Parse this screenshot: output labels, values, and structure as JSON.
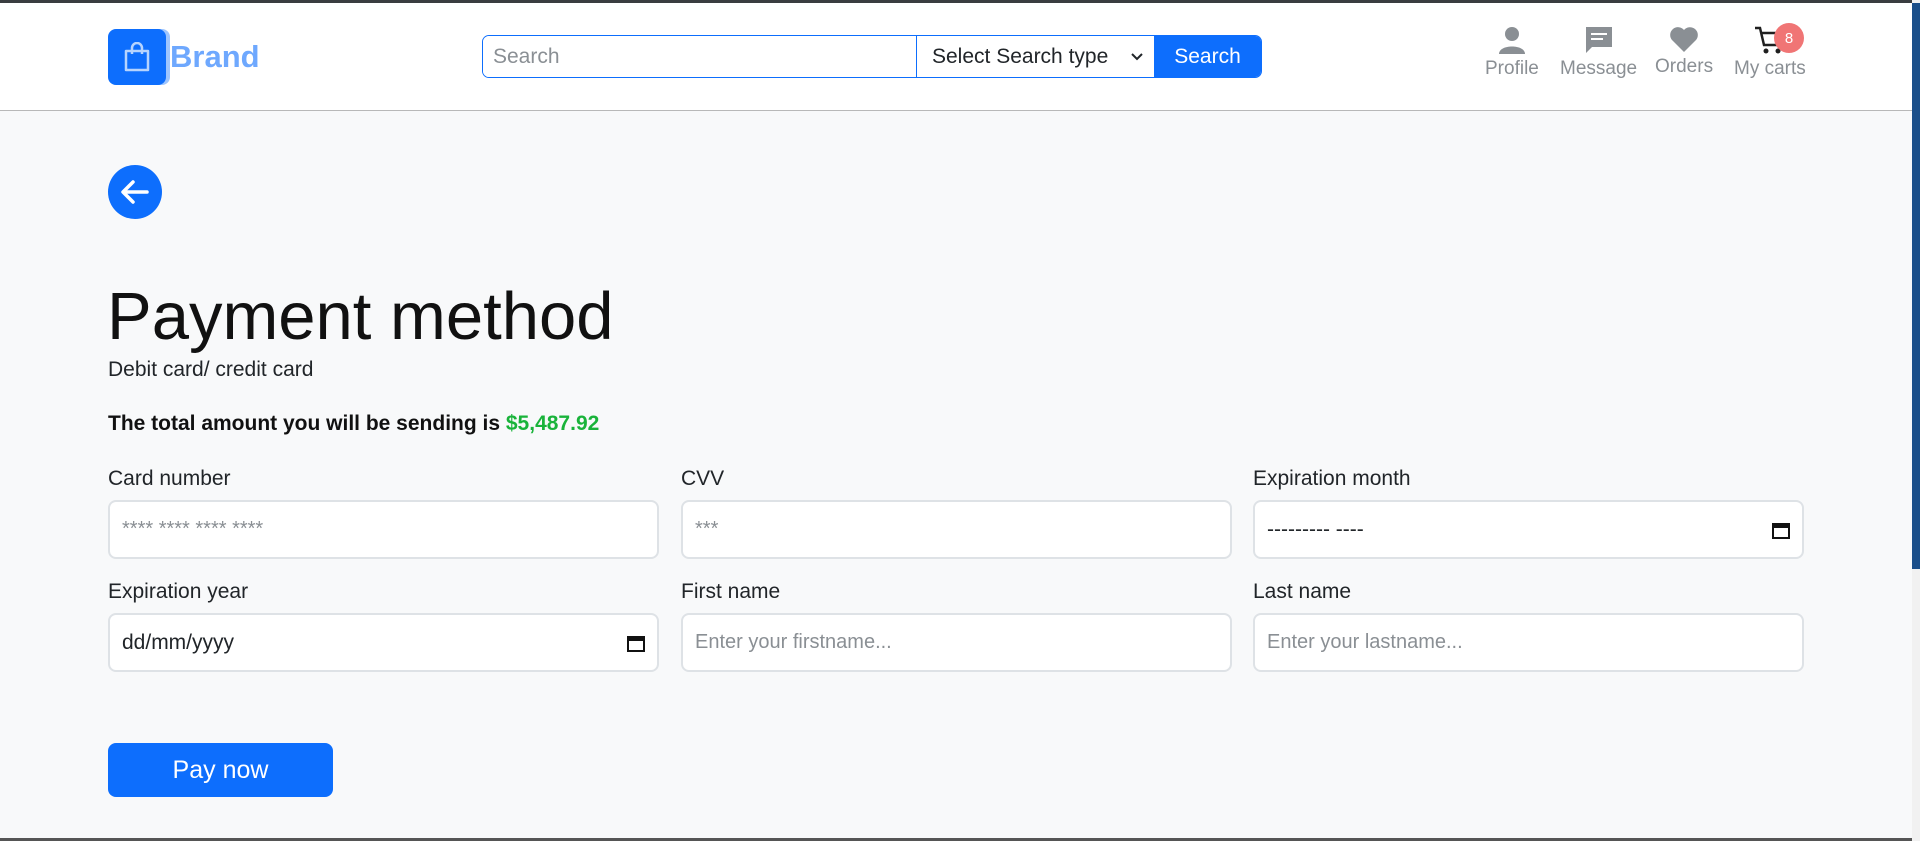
{
  "header": {
    "brand": "Brand",
    "search": {
      "placeholder": "Search",
      "type_select": "Select Search type",
      "button": "Search"
    },
    "nav": [
      {
        "label": "Profile",
        "icon": "person-icon"
      },
      {
        "label": "Message",
        "icon": "message-icon"
      },
      {
        "label": "Orders",
        "icon": "heart-icon"
      },
      {
        "label": "My carts",
        "icon": "cart-icon"
      }
    ],
    "cart_badge": "8"
  },
  "main": {
    "title": "Payment method",
    "subtitle": "Debit card/ credit card",
    "total_label": "The total amount you will be sending is",
    "total_amount": "$5,487.92",
    "fields": {
      "card_number": {
        "label": "Card number",
        "placeholder": "**** **** **** ****"
      },
      "cvv": {
        "label": "CVV",
        "placeholder": "***"
      },
      "exp_month": {
        "label": "Expiration month",
        "value": "--------- ----"
      },
      "exp_year": {
        "label": "Expiration year",
        "value": "dd/mm/yyyy"
      },
      "first_name": {
        "label": "First name",
        "placeholder": "Enter your firstname..."
      },
      "last_name": {
        "label": "Last name",
        "placeholder": "Enter your lastname..."
      }
    },
    "pay_button": "Pay now"
  },
  "colors": {
    "primary": "#0d6efd",
    "amount": "#19b33a",
    "badge": "#f07575",
    "nav_text": "#8a8f94"
  }
}
